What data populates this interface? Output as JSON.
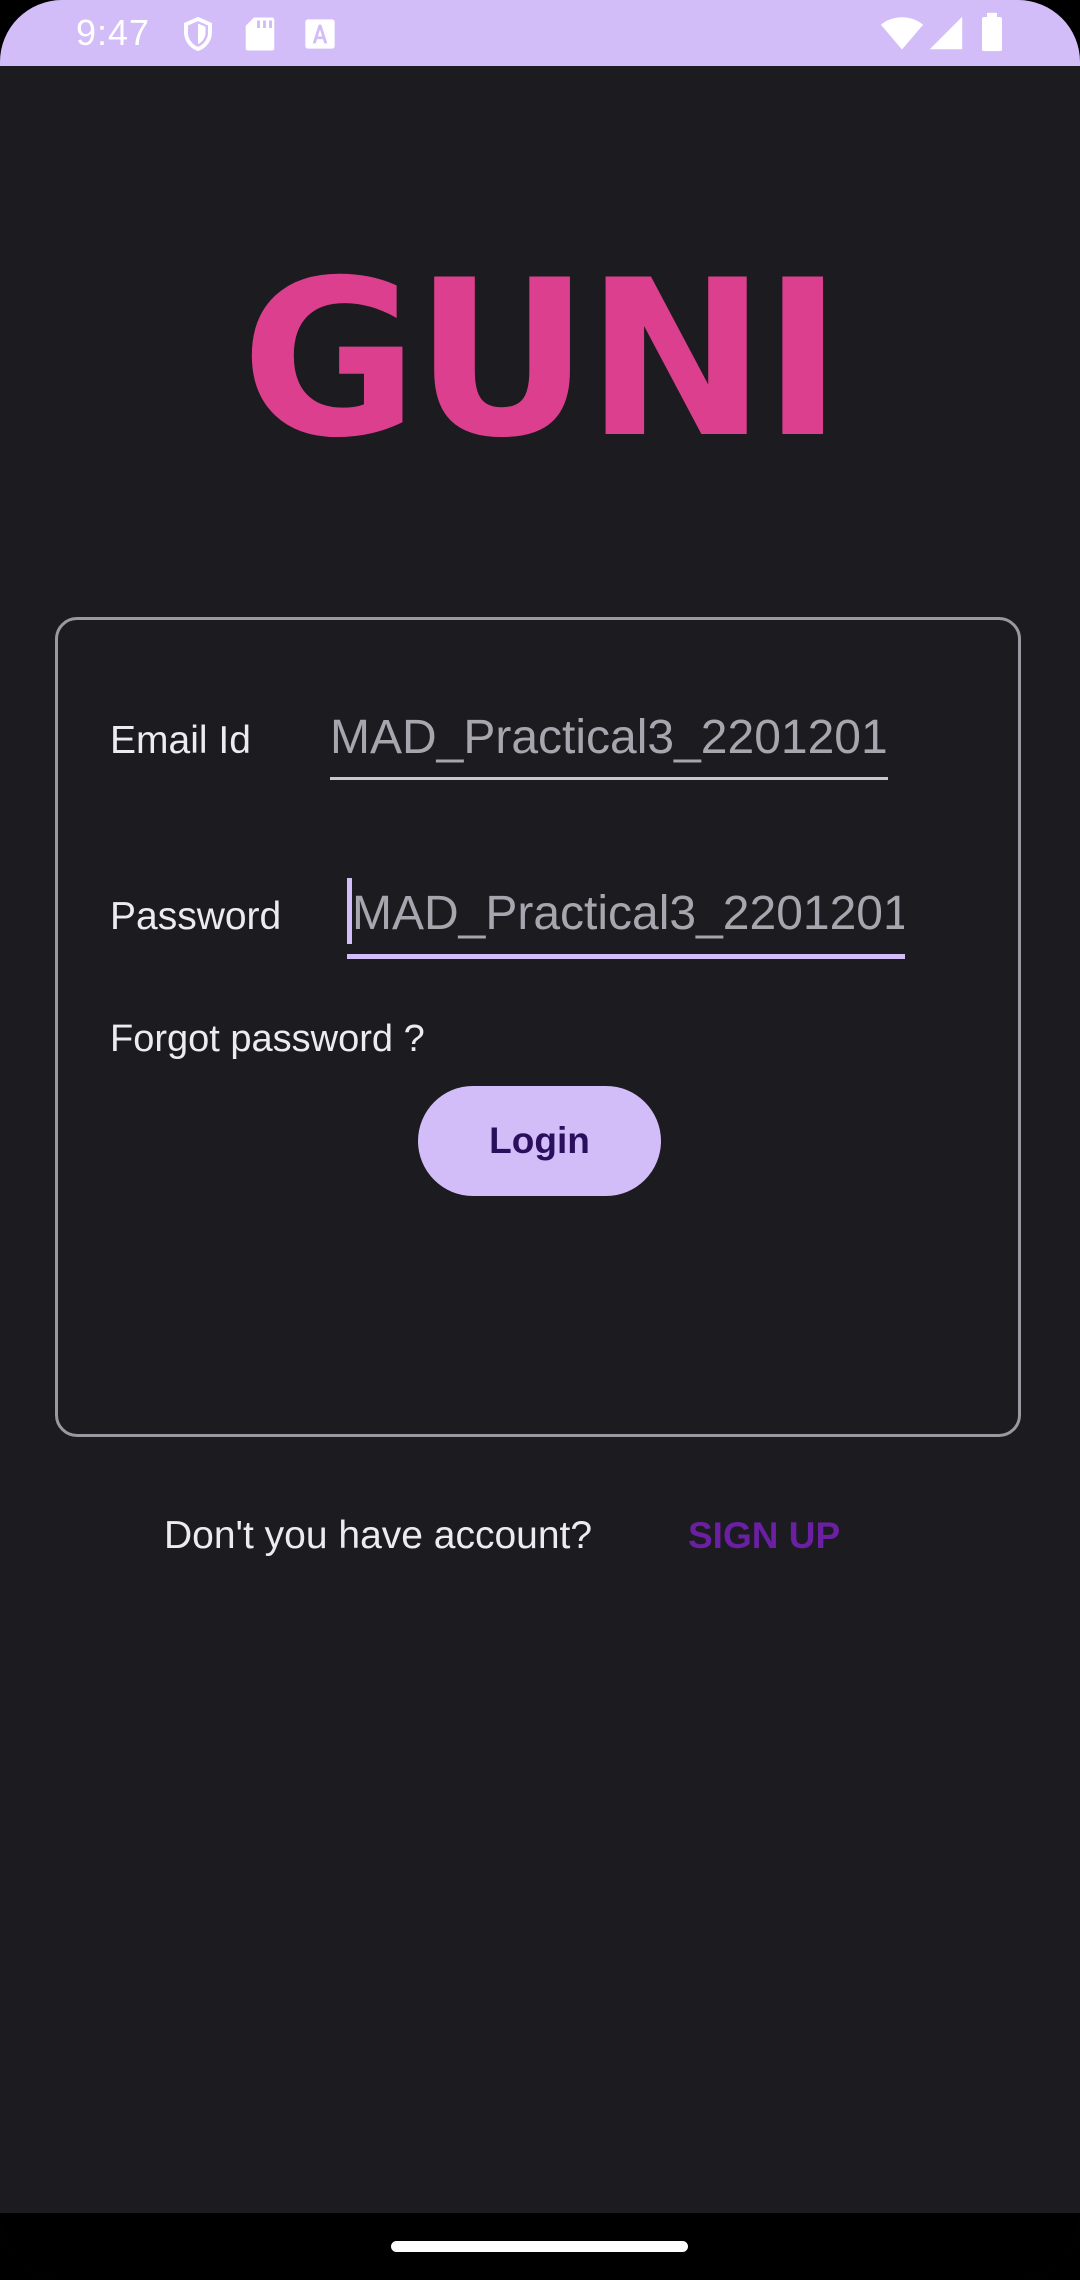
{
  "status_bar": {
    "time": "9:47",
    "icons": [
      "shield-icon",
      "sd-card-icon",
      "font-a-icon",
      "wifi-icon",
      "signal-icon",
      "battery-icon"
    ]
  },
  "app": {
    "logo": "GUNI",
    "logo_color": "#db3f8e",
    "accent_color": "#d2bdf9"
  },
  "form": {
    "email_label": "Email Id",
    "email_value": "MAD_Practical3_2201201",
    "password_label": "Password",
    "password_value": "MAD_Practical3_2201201",
    "forgot_label": "Forgot password ?",
    "login_label": "Login"
  },
  "footer": {
    "no_account_text": "Don't you have account?",
    "signup_label": "SIGN UP"
  }
}
